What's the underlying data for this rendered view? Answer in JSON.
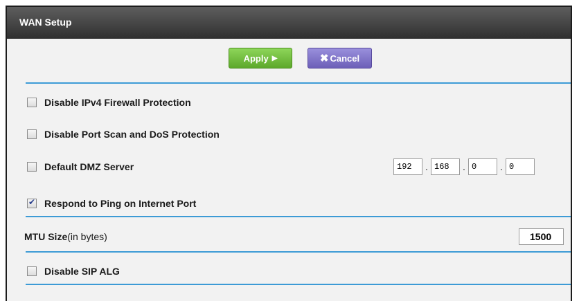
{
  "window": {
    "title": "WAN Setup"
  },
  "toolbar": {
    "apply_label": "Apply",
    "cancel_label": "Cancel"
  },
  "options": {
    "ipv4_firewall": {
      "label": "Disable IPv4 Firewall Protection",
      "checked": false
    },
    "port_scan": {
      "label": "Disable Port Scan and DoS Protection",
      "checked": false
    },
    "dmz": {
      "label": "Default DMZ Server",
      "checked": false,
      "ip": [
        "192",
        "168",
        "0",
        "0"
      ]
    },
    "ping": {
      "label": "Respond to Ping on Internet Port",
      "checked": true
    },
    "sip_alg": {
      "label": "Disable SIP ALG",
      "checked": false
    }
  },
  "mtu": {
    "label": "MTU Size",
    "unit_label": "(in bytes)",
    "value": "1500"
  },
  "colors": {
    "separator": "#3d9bd6",
    "apply": "#6fbf3a",
    "cancel": "#7b6ec9",
    "titlebar": "#3a3a3a"
  },
  "icons": {
    "apply": "play-arrow-icon",
    "cancel": "x-icon",
    "checkbox": "checkbox-icon"
  }
}
